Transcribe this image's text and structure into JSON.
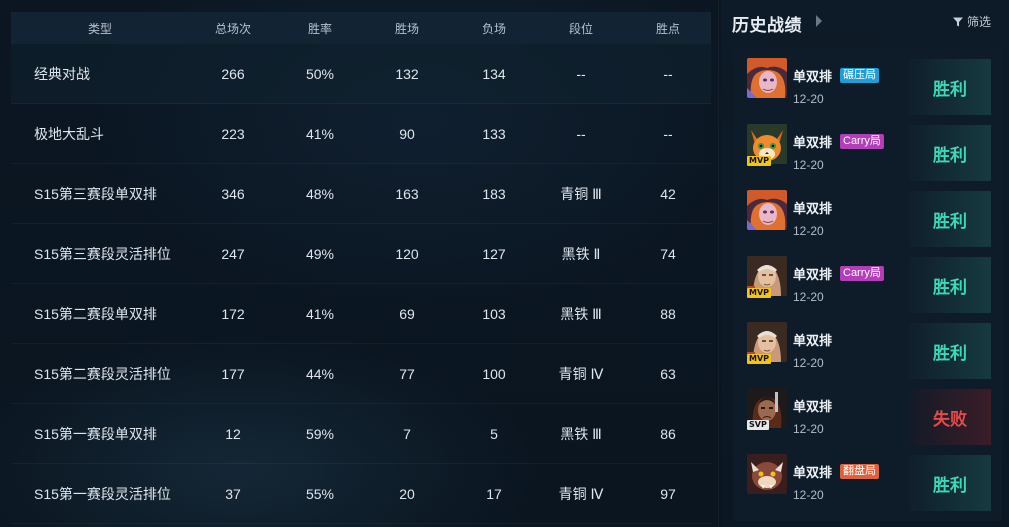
{
  "stats": {
    "columns": [
      "类型",
      "总场次",
      "胜率",
      "胜场",
      "负场",
      "段位",
      "胜点"
    ],
    "rows": [
      {
        "type": "经典对战",
        "total": "266",
        "winrate": "50%",
        "wins": "132",
        "losses": "134",
        "rank": "--",
        "lp": "--"
      },
      {
        "type": "极地大乱斗",
        "total": "223",
        "winrate": "41%",
        "wins": "90",
        "losses": "133",
        "rank": "--",
        "lp": "--"
      },
      {
        "type": "S15第三赛段单双排",
        "total": "346",
        "winrate": "48%",
        "wins": "163",
        "losses": "183",
        "rank": "青铜 Ⅲ",
        "lp": "42"
      },
      {
        "type": "S15第三赛段灵活排位",
        "total": "247",
        "winrate": "49%",
        "wins": "120",
        "losses": "127",
        "rank": "黑铁 Ⅱ",
        "lp": "74"
      },
      {
        "type": "S15第二赛段单双排",
        "total": "172",
        "winrate": "41%",
        "wins": "69",
        "losses": "103",
        "rank": "黑铁 Ⅲ",
        "lp": "88"
      },
      {
        "type": "S15第二赛段灵活排位",
        "total": "177",
        "winrate": "44%",
        "wins": "77",
        "losses": "100",
        "rank": "青铜 Ⅳ",
        "lp": "63"
      },
      {
        "type": "S15第一赛段单双排",
        "total": "12",
        "winrate": "59%",
        "wins": "7",
        "losses": "5",
        "rank": "黑铁 Ⅲ",
        "lp": "86"
      },
      {
        "type": "S15第一赛段灵活排位",
        "total": "37",
        "winrate": "55%",
        "wins": "20",
        "losses": "17",
        "rank": "青铜 Ⅳ",
        "lp": "97"
      }
    ]
  },
  "history": {
    "title": "历史战绩",
    "filter_label": "筛选",
    "matches": [
      {
        "mode": "单双排",
        "tag": "碾压局",
        "tag_color": "#1e9ed8",
        "date": "12-20",
        "badge": "",
        "result": "胜利",
        "outcome": "win",
        "champion_icon": "champion-portrait-red-hair"
      },
      {
        "mode": "单双排",
        "tag": "Carry局",
        "tag_color": "#b23fb8",
        "date": "12-20",
        "badge": "MVP",
        "result": "胜利",
        "outcome": "win",
        "champion_icon": "champion-portrait-fox"
      },
      {
        "mode": "单双排",
        "tag": "",
        "tag_color": "",
        "date": "12-20",
        "badge": "",
        "result": "胜利",
        "outcome": "win",
        "champion_icon": "champion-portrait-red-hair"
      },
      {
        "mode": "单双排",
        "tag": "Carry局",
        "tag_color": "#b23fb8",
        "date": "12-20",
        "badge": "MVP",
        "result": "胜利",
        "outcome": "win",
        "champion_icon": "champion-portrait-monk"
      },
      {
        "mode": "单双排",
        "tag": "",
        "tag_color": "",
        "date": "12-20",
        "badge": "MVP",
        "result": "胜利",
        "outcome": "win",
        "champion_icon": "champion-portrait-monk"
      },
      {
        "mode": "单双排",
        "tag": "",
        "tag_color": "",
        "date": "12-20",
        "badge": "SVP",
        "result": "失败",
        "outcome": "loss",
        "champion_icon": "champion-portrait-warrior"
      },
      {
        "mode": "单双排",
        "tag": "翻盘局",
        "tag_color": "#e0603a",
        "date": "12-20",
        "badge": "",
        "result": "胜利",
        "outcome": "win",
        "champion_icon": "champion-portrait-beast"
      }
    ]
  },
  "colors": {
    "win": "#3dd9b6",
    "loss": "#e24b4b",
    "mvp": "#f2c418"
  }
}
